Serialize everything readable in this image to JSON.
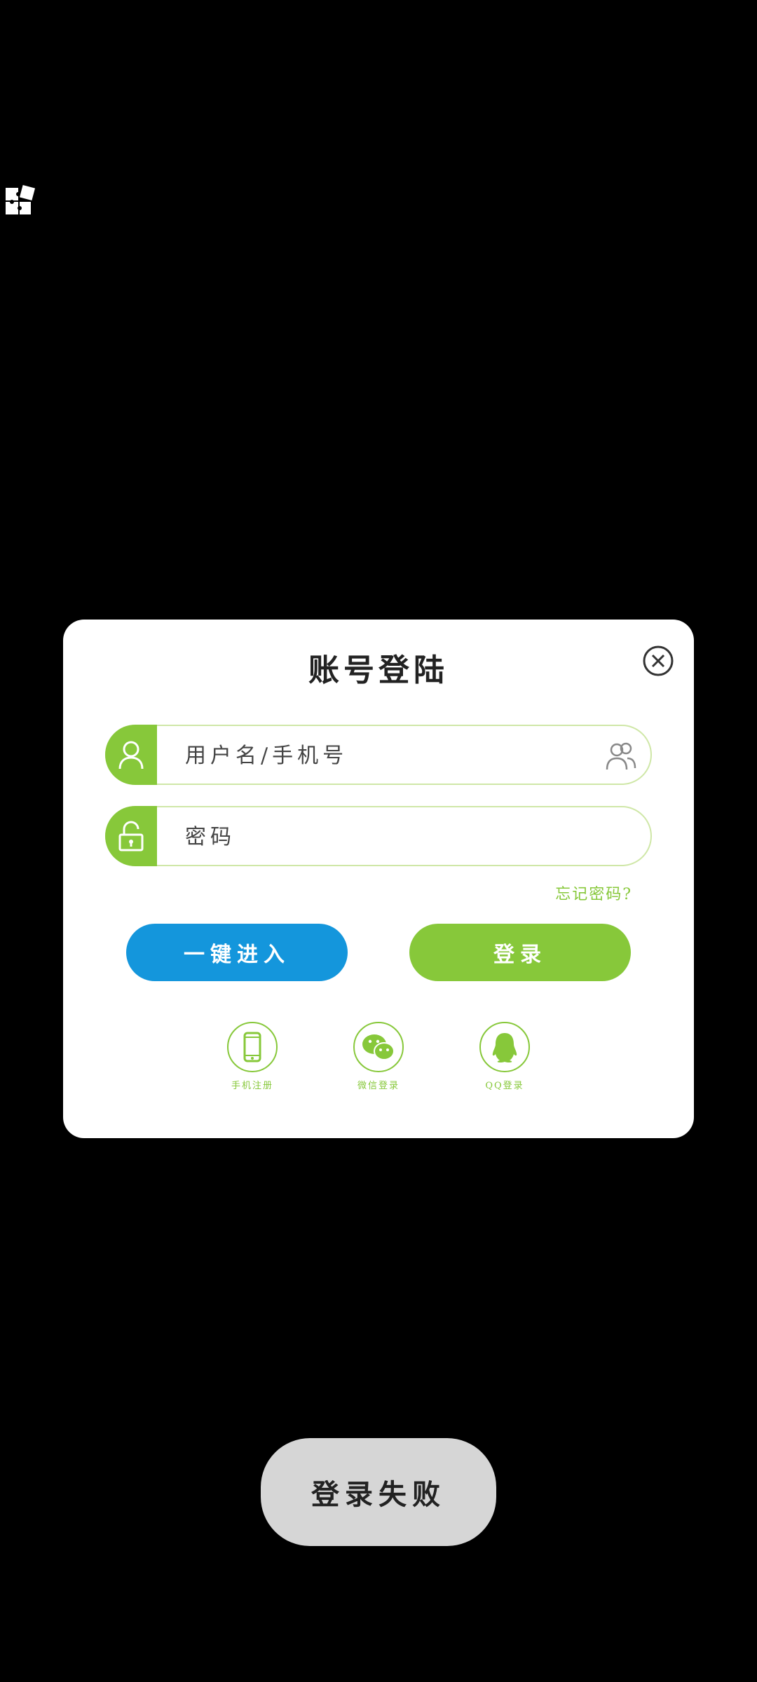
{
  "dialog": {
    "title": "账号登陆",
    "username_placeholder": "用户名/手机号",
    "password_placeholder": "密码",
    "forgot_link": "忘记密码?",
    "quick_enter_label": "一键进入",
    "login_label": "登录",
    "social": [
      {
        "label": "手机注册",
        "icon": "phone-icon"
      },
      {
        "label": "微信登录",
        "icon": "wechat-icon"
      },
      {
        "label": "QQ登录",
        "icon": "qq-icon"
      }
    ]
  },
  "toast": {
    "message": "登录失败"
  },
  "colors": {
    "accent_green": "#87c83a",
    "accent_blue": "#1496dc",
    "toast_bg": "#d6d6d6",
    "background": "#000000"
  }
}
